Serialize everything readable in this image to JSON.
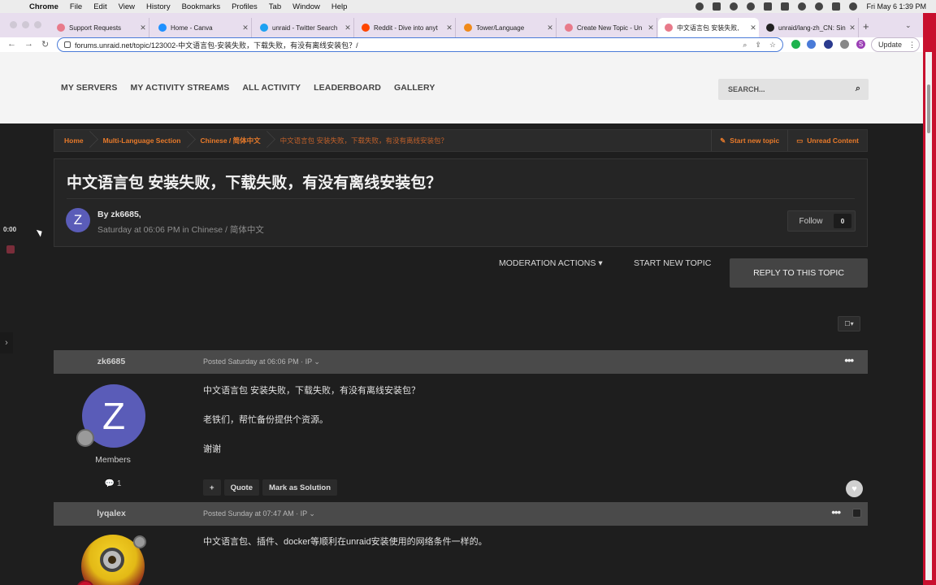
{
  "menubar": {
    "app": "Chrome",
    "items": [
      "File",
      "Edit",
      "View",
      "History",
      "Bookmarks",
      "Profiles",
      "Tab",
      "Window",
      "Help"
    ],
    "clock": "Fri May 6  1:39 PM"
  },
  "tabs": [
    {
      "title": "Support Requests",
      "color": "#e87a8a"
    },
    {
      "title": "Home - Canva",
      "color": "#1e90ff"
    },
    {
      "title": "unraid - Twitter Search",
      "color": "#1da1f2"
    },
    {
      "title": "Reddit - Dive into anyt",
      "color": "#ff4500"
    },
    {
      "title": "Tower/Language",
      "color": "#f08a1a"
    },
    {
      "title": "Create New Topic - Un",
      "color": "#e87a8a"
    },
    {
      "title": "中文语言包 安装失败,",
      "color": "#e87a8a"
    },
    {
      "title": "unraid/lang-zh_CN: Sin",
      "color": "#222222"
    }
  ],
  "toolbar": {
    "url": "forums.unraid.net/topic/123002-中文语言包-安装失败，下载失败，有没有离线安装包？/",
    "update_label": "Update",
    "profile_initial": "S"
  },
  "nav": {
    "links": [
      "MY SERVERS",
      "MY ACTIVITY STREAMS",
      "ALL ACTIVITY",
      "LEADERBOARD",
      "GALLERY"
    ],
    "search_placeholder": "SEARCH..."
  },
  "breadcrumb": {
    "items": [
      "Home",
      "Multi-Language Section",
      "Chinese / 简体中文",
      "中文语言包 安装失败，下载失败，有没有离线安装包？"
    ],
    "start_new_topic": "Start new topic",
    "unread_content": "Unread Content"
  },
  "topic": {
    "title": "中文语言包 安装失败，下载失败，有没有离线安装包？",
    "author_initial": "Z",
    "by_line": "By zk6685,",
    "meta": "Saturday at 06:06 PM  in Chinese / 简体中文",
    "follow_label": "Follow",
    "follow_count": "0"
  },
  "actions": {
    "moderation": "MODERATION ACTIONS ▾",
    "start_new_topic": "START NEW TOPIC",
    "reply": "REPLY TO THIS TOPIC"
  },
  "posts": [
    {
      "author": "zk6685",
      "date": "Posted Saturday at 06:06 PM · IP ⌄",
      "avatar_initial": "Z",
      "group": "Members",
      "post_count": "💬 1",
      "lines": [
        "中文语言包 安装失败，下载失败，有没有离线安装包？",
        "老铁们，帮忙备份提供个资源。",
        "谢谢"
      ],
      "tools": {
        "add": "+",
        "quote": "Quote",
        "solution": "Mark as Solution"
      }
    },
    {
      "author": "lyqalex",
      "date": "Posted Sunday at 07:47 AM · IP ⌄",
      "lines": [
        "中文语言包、插件、docker等顺利在unraid安装使用的网络条件一样的。"
      ]
    }
  ],
  "sidebar": {
    "timer": "0:00"
  }
}
